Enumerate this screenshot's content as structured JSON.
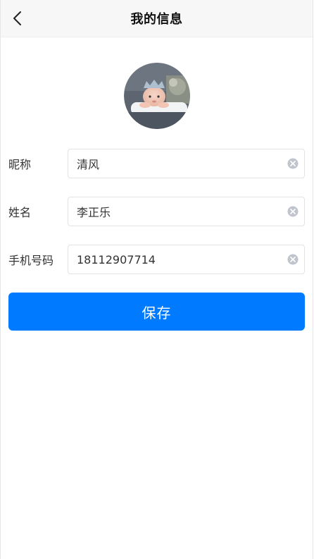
{
  "header": {
    "title": "我的信息",
    "back_icon": "chevron-left-icon"
  },
  "profile": {
    "avatar_alt": "baby-photo"
  },
  "form": {
    "nickname": {
      "label": "昵称",
      "value": "清风"
    },
    "name": {
      "label": "姓名",
      "value": "李正乐"
    },
    "phone": {
      "label": "手机号码",
      "value": "18112907714"
    }
  },
  "actions": {
    "save_label": "保存"
  },
  "colors": {
    "accent": "#007bff",
    "nav_bg": "#f7f7f7",
    "clear_icon": "#c0c4cc"
  }
}
